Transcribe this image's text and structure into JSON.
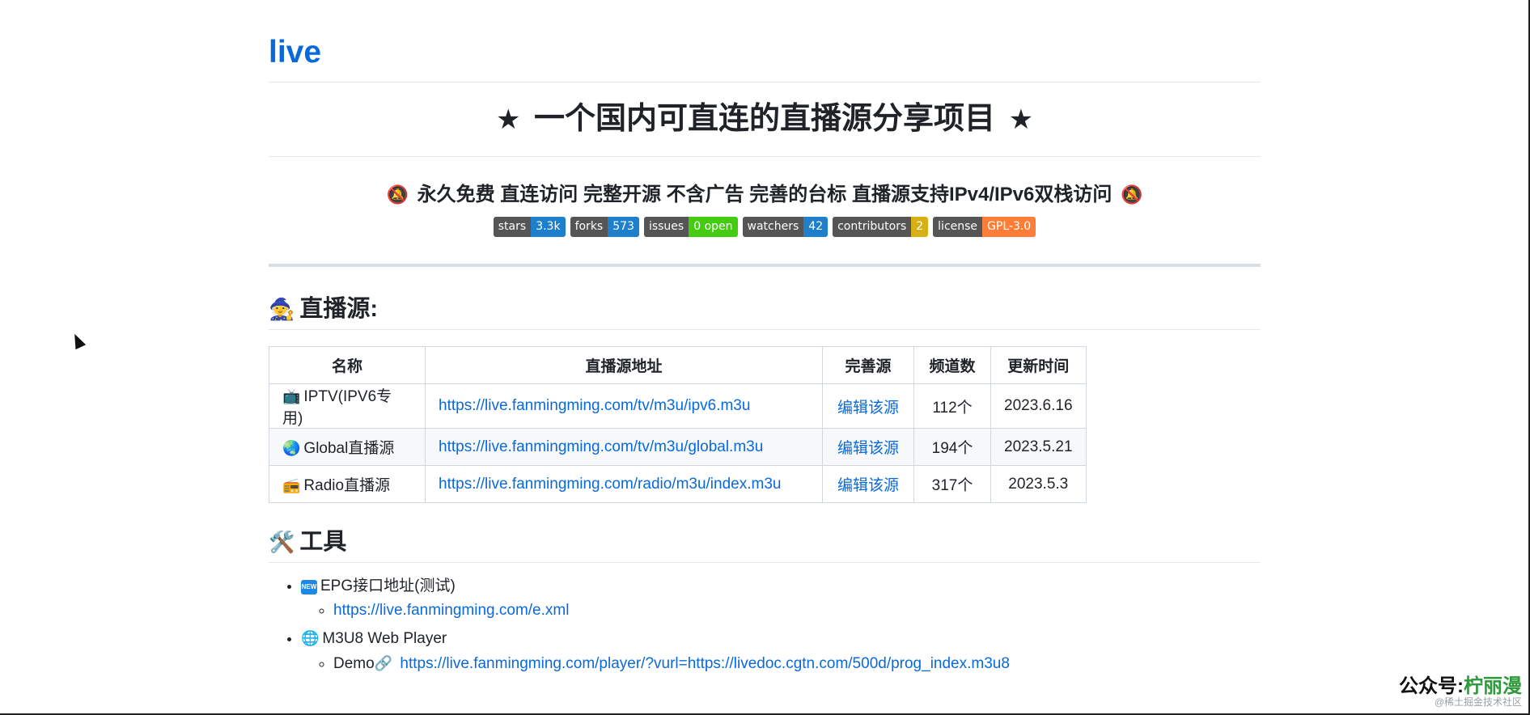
{
  "repo": {
    "name": "live"
  },
  "hero": {
    "star": "★",
    "title": "一个国内可直连的直播源分享项目"
  },
  "tagline": {
    "icon": "🔕",
    "text": "永久免费 直连访问 完整开源 不含广告 完善的台标 直播源支持IPv4/IPv6双栈访问"
  },
  "badges": [
    {
      "label": "stars",
      "value": "3.3k",
      "color": "#1e7fcd"
    },
    {
      "label": "forks",
      "value": "573",
      "color": "#1e7fcd"
    },
    {
      "label": "issues",
      "value": "0 open",
      "color": "#44cc11"
    },
    {
      "label": "watchers",
      "value": "42",
      "color": "#1e7fcd"
    },
    {
      "label": "contributors",
      "value": "2",
      "color": "#d8b014"
    },
    {
      "label": "license",
      "value": "GPL-3.0",
      "color": "#fe7d37"
    }
  ],
  "live_section": {
    "icon": "🧙",
    "title": "直播源:",
    "headers": [
      "名称",
      "直播源地址",
      "完善源",
      "频道数",
      "更新时间"
    ],
    "rows": [
      {
        "icon": "📺",
        "name": "IPTV(IPV6专用)",
        "url": "https://live.fanmingming.com/tv/m3u/ipv6.m3u",
        "edit": "编辑该源",
        "channels": "112个",
        "updated": "2023.6.16"
      },
      {
        "icon": "🌏",
        "name": "Global直播源",
        "url": "https://live.fanmingming.com/tv/m3u/global.m3u",
        "edit": "编辑该源",
        "channels": "194个",
        "updated": "2023.5.21"
      },
      {
        "icon": "📻",
        "name": "Radio直播源",
        "url": "https://live.fanmingming.com/radio/m3u/index.m3u",
        "edit": "编辑该源",
        "channels": "317个",
        "updated": "2023.5.3"
      }
    ]
  },
  "tools_section": {
    "icon": "🛠️",
    "title": "工具",
    "items": [
      {
        "icon": "new-badge",
        "badge_text": "NEW",
        "label": "EPG接口地址(测试)",
        "sub_prefix": "",
        "sub_link": "https://live.fanmingming.com/e.xml"
      },
      {
        "icon": "🌐",
        "label": "M3U8 Web Player",
        "sub_prefix": "Demo",
        "sub_icon": "🔗",
        "sub_link": "https://live.fanmingming.com/player/?vurl=https://livedoc.cgtn.com/500d/prog_index.m3u8"
      }
    ]
  },
  "watermark": {
    "line1_prefix": "公众号:",
    "line1_name": "柠丽漫",
    "line2": "@稀土掘金技术社区"
  }
}
